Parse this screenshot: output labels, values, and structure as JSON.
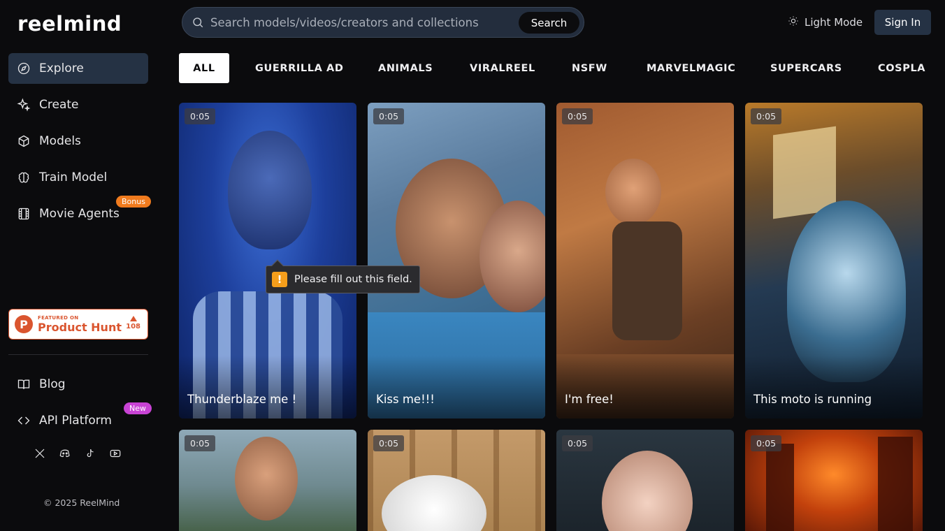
{
  "brand": {
    "logo": "reelmind"
  },
  "sidebar": {
    "items": [
      {
        "label": "Explore",
        "icon": "compass-icon",
        "active": true
      },
      {
        "label": "Create",
        "icon": "sparkle-icon"
      },
      {
        "label": "Models",
        "icon": "cube-icon"
      },
      {
        "label": "Train Model",
        "icon": "brain-icon"
      },
      {
        "label": "Movie Agents",
        "icon": "film-icon",
        "badge": "Bonus"
      }
    ],
    "product_hunt": {
      "featured": "FEATURED ON",
      "name": "Product Hunt",
      "count": "108",
      "logo_letter": "P"
    },
    "bottom_items": [
      {
        "label": "Blog",
        "icon": "book-icon"
      },
      {
        "label": "API Platform",
        "icon": "code-icon",
        "badge": "New"
      }
    ],
    "socials": [
      "x-icon",
      "discord-icon",
      "tiktok-icon",
      "youtube-icon"
    ],
    "copyright": "© 2025 ReelMind"
  },
  "header": {
    "search_placeholder": "Search models/videos/creators and collections",
    "search_button": "Search",
    "light_mode": "Light Mode",
    "sign_in": "Sign In"
  },
  "tabs": [
    "ALL",
    "GUERRILLA AD",
    "ANIMALS",
    "VIRALREEL",
    "NSFW",
    "MARVELMAGIC",
    "SUPERCARS",
    "COSPLA"
  ],
  "cards": [
    {
      "duration": "0:05",
      "title": "Thunderblaze me !"
    },
    {
      "duration": "0:05",
      "title": "Kiss me!!!"
    },
    {
      "duration": "0:05",
      "title": "I'm free!"
    },
    {
      "duration": "0:05",
      "title": "This moto is running"
    },
    {
      "duration": "0:05",
      "title": ""
    },
    {
      "duration": "0:05",
      "title": ""
    },
    {
      "duration": "0:05",
      "title": ""
    },
    {
      "duration": "0:05",
      "title": ""
    }
  ],
  "tooltip": {
    "icon": "!",
    "text": "Please fill out this field."
  },
  "colors": {
    "background": "#0b0b0d",
    "active_nav": "#253244",
    "bonus_badge": "#f07b1e",
    "new_badge": "#c843d4",
    "product_hunt": "#da552f",
    "warning": "#f59e1b"
  }
}
